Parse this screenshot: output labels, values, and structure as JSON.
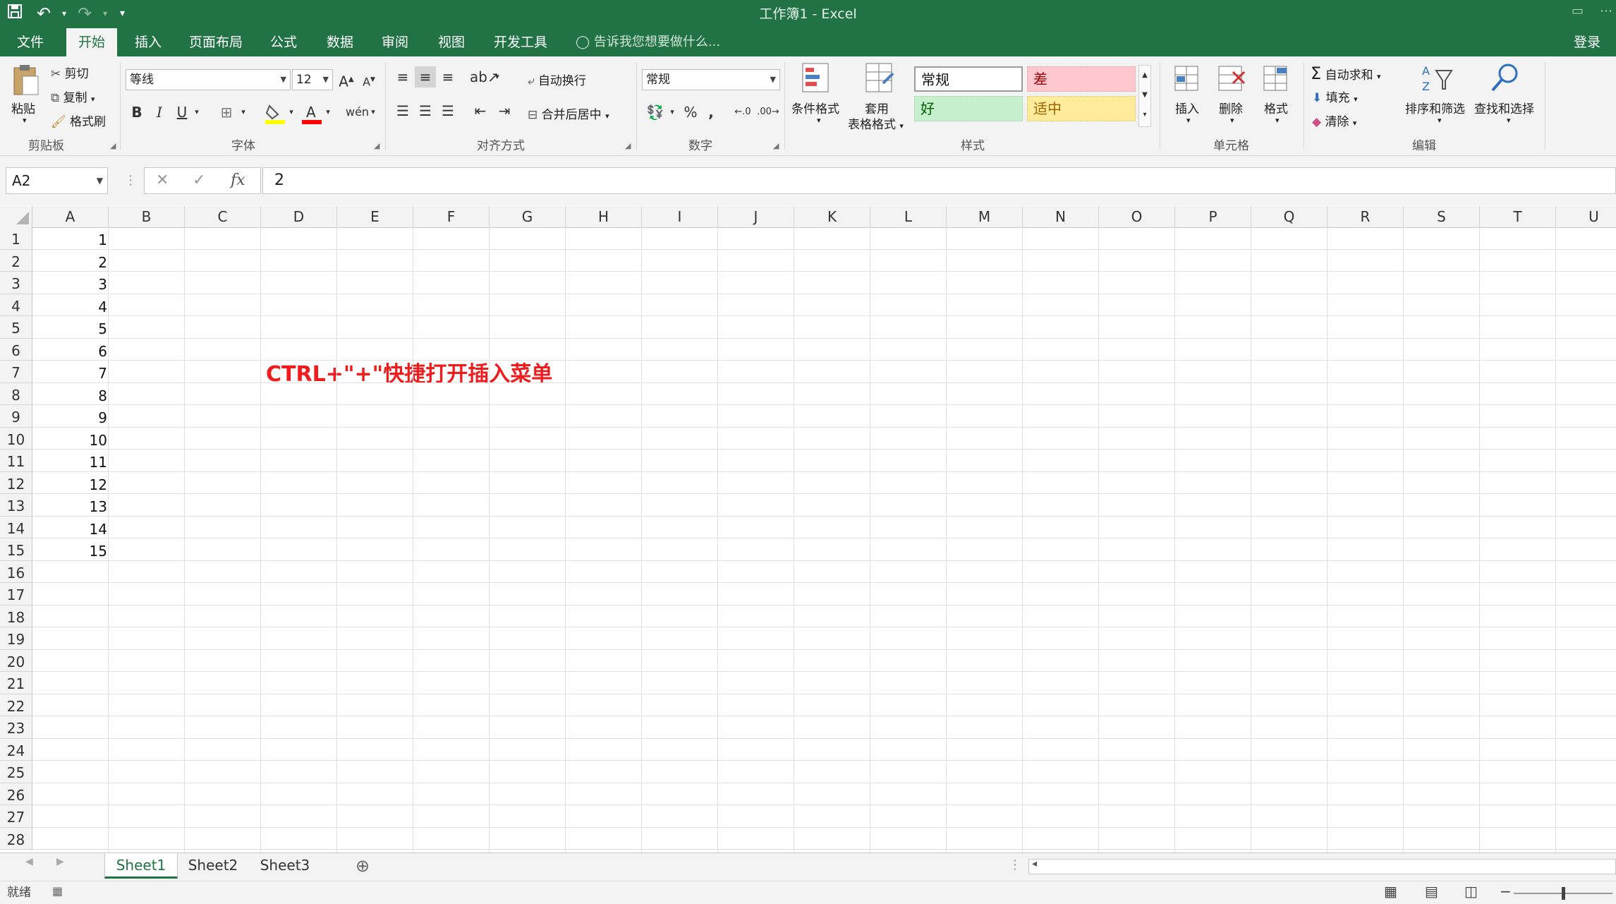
{
  "titlebar": {
    "title": "工作簿1 - Excel",
    "save_icon": "save-icon",
    "undo_icon": "undo-icon",
    "redo_icon": "redo-icon"
  },
  "tabs": [
    {
      "label": "文件"
    },
    {
      "label": "开始",
      "active": true
    },
    {
      "label": "插入"
    },
    {
      "label": "页面布局"
    },
    {
      "label": "公式"
    },
    {
      "label": "数据"
    },
    {
      "label": "审阅"
    },
    {
      "label": "视图"
    },
    {
      "label": "开发工具"
    }
  ],
  "tellme": "告诉我您想要做什么...",
  "login": "登录",
  "ribbon": {
    "clipboard": {
      "paste": "粘贴",
      "cut": "剪切",
      "copy": "复制",
      "format_painter": "格式刷",
      "label": "剪贴板"
    },
    "font": {
      "name": "等线",
      "size": "12",
      "label": "字体"
    },
    "alignment": {
      "wrap": "自动换行",
      "merge": "合并后居中",
      "label": "对齐方式"
    },
    "number": {
      "format": "常规",
      "label": "数字"
    },
    "styles": {
      "conditional": "条件格式",
      "table_format_1": "套用",
      "table_format_2": "表格格式",
      "normal": "常规",
      "bad": "差",
      "good": "好",
      "neutral": "适中",
      "label": "样式"
    },
    "cells": {
      "insert": "插入",
      "delete": "删除",
      "format": "格式",
      "label": "单元格"
    },
    "editing": {
      "autosum": "自动求和",
      "fill": "填充",
      "clear": "清除",
      "sort": "排序和筛选",
      "find": "查找和选择",
      "label": "编辑"
    }
  },
  "formula_bar": {
    "namebox": "A2",
    "fx": "fx",
    "value": "2"
  },
  "columns": [
    "A",
    "B",
    "C",
    "D",
    "E",
    "F",
    "G",
    "H",
    "I",
    "J",
    "K",
    "L",
    "M",
    "N",
    "O",
    "P",
    "Q",
    "R",
    "S",
    "T",
    "U"
  ],
  "rows": [
    "1",
    "2",
    "3",
    "4",
    "5",
    "6",
    "7",
    "8",
    "9",
    "10",
    "11",
    "12",
    "13",
    "14",
    "15",
    "16",
    "17",
    "18",
    "19",
    "20",
    "21",
    "22",
    "23",
    "24",
    "25",
    "26",
    "27",
    "28"
  ],
  "cells_A": [
    "1",
    "2",
    "3",
    "4",
    "5",
    "6",
    "7",
    "8",
    "9",
    "10",
    "11",
    "12",
    "13",
    "14",
    "15"
  ],
  "note": "CTRL+\"+\"快捷打开插入菜单",
  "sheets": [
    "Sheet1",
    "Sheet2",
    "Sheet3"
  ],
  "status": "就绪",
  "colors": {
    "excel_green": "#217346",
    "note_red": "#ee1c1c",
    "bad_bg": "#ffc7ce",
    "good_bg": "#c6efce",
    "neutral_bg": "#ffeb9c"
  }
}
